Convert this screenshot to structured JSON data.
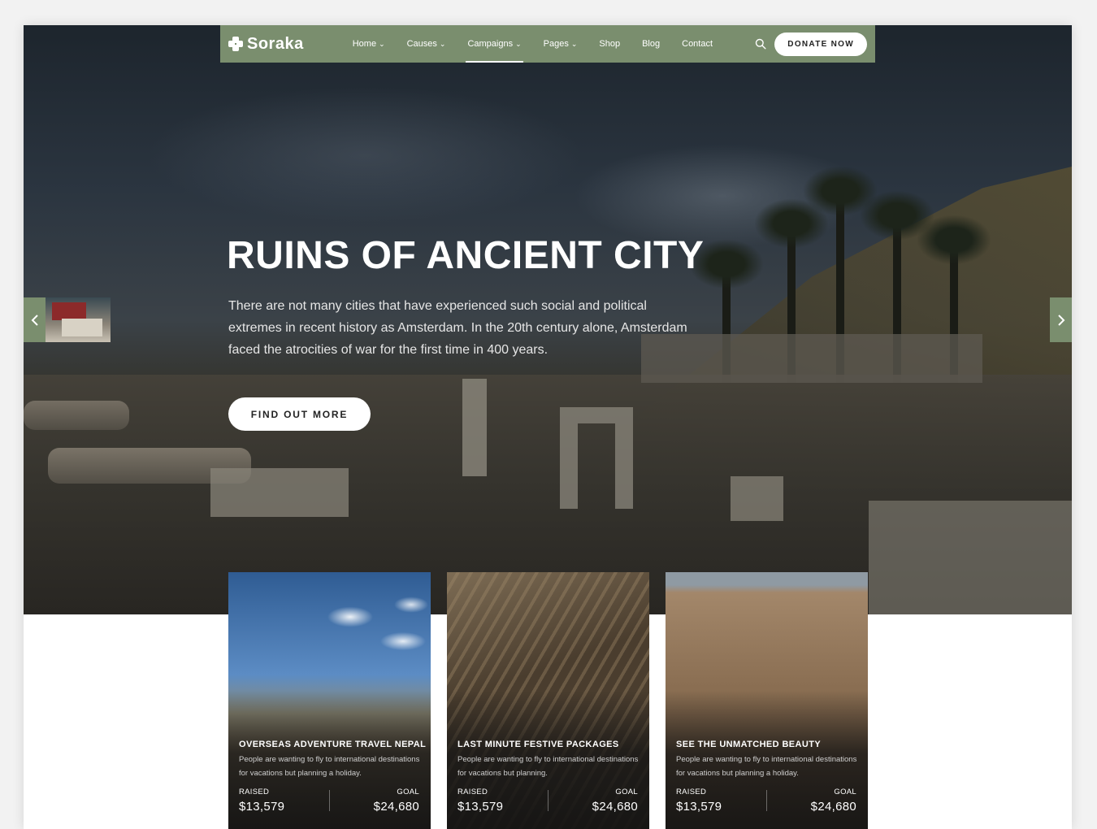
{
  "brand": {
    "name": "Soraka"
  },
  "nav": {
    "items": [
      {
        "label": "Home",
        "dropdown": true
      },
      {
        "label": "Causes",
        "dropdown": true
      },
      {
        "label": "Campaigns",
        "dropdown": true,
        "active": true
      },
      {
        "label": "Pages",
        "dropdown": true
      },
      {
        "label": "Shop",
        "dropdown": false
      },
      {
        "label": "Blog",
        "dropdown": false
      },
      {
        "label": "Contact",
        "dropdown": false
      }
    ],
    "donate_label": "DONATE NOW",
    "search_icon": "search-icon"
  },
  "hero": {
    "title": "RUINS OF ANCIENT CITY",
    "description": "There are not many cities that have experienced such social and political extremes in recent history as Amsterdam. In the 20th century alone, Amsterdam faced the atrocities of war for the first time in 400 years.",
    "cta_label": "FIND OUT MORE",
    "prev_icon": "chevron-left-icon",
    "next_icon": "chevron-right-icon"
  },
  "cards": [
    {
      "title": "OVERSEAS ADVENTURE TRAVEL NEPAL",
      "description": "People are wanting to fly to international destinations for vacations but planning a holiday.",
      "raised_label": "RAISED",
      "raised": "$13,579",
      "goal_label": "GOAL",
      "goal": "$24,680"
    },
    {
      "title": "LAST MINUTE FESTIVE PACKAGES",
      "description": "People are wanting to fly to international destinations for vacations but planning.",
      "raised_label": "RAISED",
      "raised": "$13,579",
      "goal_label": "GOAL",
      "goal": "$24,680"
    },
    {
      "title": "SEE THE UNMATCHED BEAUTY",
      "description": "People are wanting to fly to international destinations for vacations but planning a holiday.",
      "raised_label": "RAISED",
      "raised": "$13,579",
      "goal_label": "GOAL",
      "goal": "$24,680"
    }
  ],
  "colors": {
    "accent": "#7a8e6e",
    "hero_dark": "#1d252d",
    "white": "#ffffff",
    "button_text": "#222222"
  }
}
